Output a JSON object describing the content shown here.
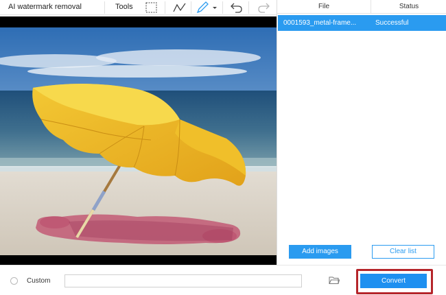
{
  "toolbar": {
    "title": "AI watermark removal",
    "tools_label": "Tools",
    "icons": [
      "rectangle-select-icon",
      "polyline-icon",
      "brush-icon",
      "undo-icon",
      "redo-icon"
    ]
  },
  "file_list": {
    "columns": [
      "File",
      "Status"
    ],
    "rows": [
      {
        "name": "0001593_metal-frame...",
        "status": "Successful"
      }
    ],
    "selected_row": 0,
    "add_images_label": "Add images",
    "clear_list_label": "Clear list"
  },
  "output": {
    "custom_label": "Custom",
    "path_value": "",
    "convert_label": "Convert"
  },
  "colors": {
    "accent": "#2a9bf0",
    "highlight_frame": "#b5252a",
    "mask": "#c0506e"
  }
}
